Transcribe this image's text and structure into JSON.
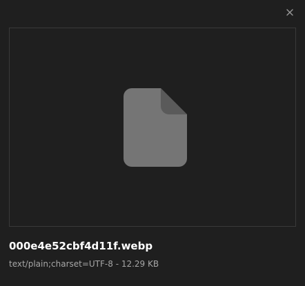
{
  "dialog": {
    "close_icon": "close-icon",
    "preview_icon": "file-document-icon",
    "file_name": "000e4e52cbf4d11f.webp",
    "file_meta": "text/plain;charset=UTF-8 - 12.29 KB"
  },
  "colors": {
    "background": "#1f1f1f",
    "frame_border": "#3a3a3a",
    "icon_body": "#757575",
    "icon_fold": "#5a5a5a",
    "title": "#ffffff",
    "meta": "#a7a7a7"
  }
}
